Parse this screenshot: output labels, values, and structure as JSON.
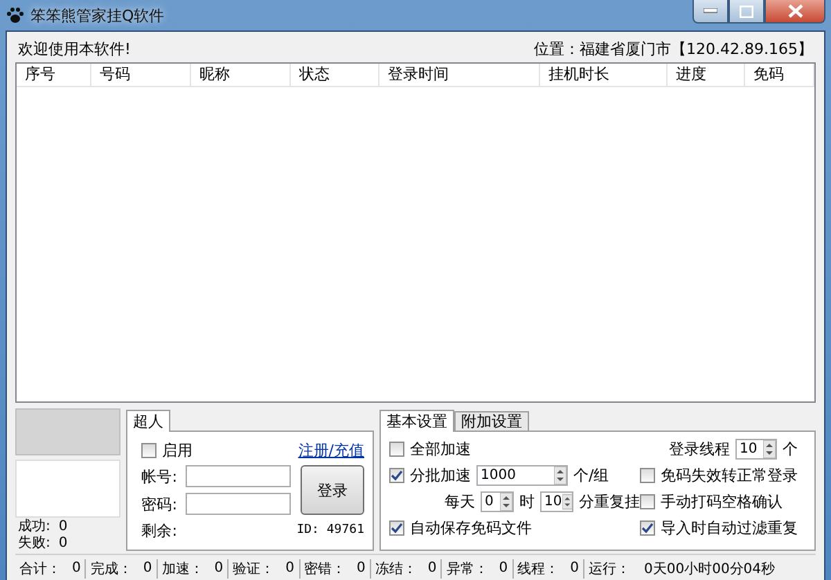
{
  "window": {
    "title": "笨笨熊管家挂Q软件"
  },
  "header": {
    "welcome": "欢迎使用本软件!",
    "location": "位置：福建省厦门市【120.42.89.165】"
  },
  "table": {
    "columns": [
      "序号",
      "号码",
      "昵称",
      "状态",
      "登录时间",
      "挂机时长",
      "进度",
      "免码"
    ]
  },
  "stats": [
    {
      "label": "成功:",
      "value": "0"
    },
    {
      "label": "失败:",
      "value": "0"
    }
  ],
  "login": {
    "tabs": [
      {
        "label": "超人",
        "selected": true
      }
    ],
    "enable": {
      "label": "启用",
      "checked": false
    },
    "link": "注册/充值",
    "account_label": "帐号:",
    "password_label": "密码:",
    "button": "登录",
    "remaining_label": "剩余:",
    "id": "ID: 49761"
  },
  "settings": {
    "tabs": [
      {
        "label": "基本设置",
        "selected": true
      },
      {
        "label": "附加设置",
        "selected": false
      }
    ],
    "all_speed": {
      "label": "全部加速",
      "checked": false
    },
    "batch": {
      "label": "分批加速",
      "checked": true,
      "value": "1000",
      "unit": "个/组"
    },
    "daily": {
      "label": "每天",
      "hour_value": "0",
      "hour_unit": "时",
      "minute_value": "10",
      "minute_unit": "分重复挂"
    },
    "auto_save": {
      "label": "自动保存免码文件",
      "checked": true
    },
    "threads": {
      "label": "登录线程",
      "value": "10",
      "unit": "个"
    },
    "options": [
      {
        "label": "免码失效转正常登录",
        "checked": false
      },
      {
        "label": "手动打码空格确认",
        "checked": false
      },
      {
        "label": "导入时自动过滤重复",
        "checked": true
      }
    ]
  },
  "status_bar": [
    {
      "label": "合计：",
      "value": "0"
    },
    {
      "label": "完成：",
      "value": "0"
    },
    {
      "label": "加速：",
      "value": "0"
    },
    {
      "label": "验证：",
      "value": "0"
    },
    {
      "label": "密错：",
      "value": "0"
    },
    {
      "label": "冻结：",
      "value": "0"
    },
    {
      "label": "异常：",
      "value": "0"
    },
    {
      "label": "线程：",
      "value": "0"
    },
    {
      "label": "运行：",
      "value": "0天00小时00分04秒"
    }
  ]
}
